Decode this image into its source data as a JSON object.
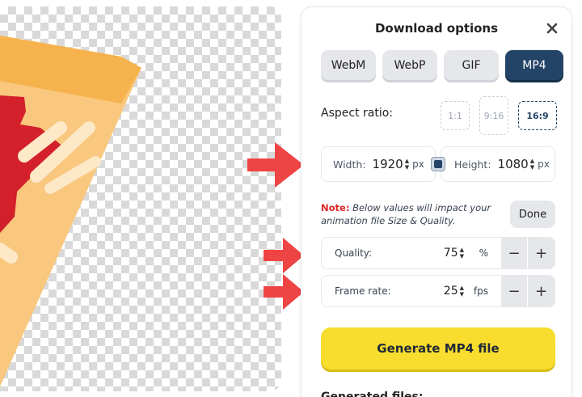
{
  "panel": {
    "title": "Download options",
    "formats": [
      {
        "label": "WebM",
        "active": false
      },
      {
        "label": "WebP",
        "active": false
      },
      {
        "label": "GIF",
        "active": false
      },
      {
        "label": "MP4",
        "active": true
      }
    ],
    "aspect_ratio": {
      "label": "Aspect ratio:",
      "options": [
        "1:1",
        "9:16",
        "16:9"
      ],
      "selected": "16:9"
    },
    "dimensions": {
      "width_label": "Width:",
      "width_value": "1920",
      "height_label": "Height:",
      "height_value": "1080",
      "unit": "px"
    },
    "note": {
      "prefix": "Note:",
      "text": "Below values will impact your animation file Size & Quality."
    },
    "done_label": "Done",
    "quality": {
      "label": "Quality:",
      "value": "75",
      "unit": "%"
    },
    "frame_rate": {
      "label": "Frame rate:",
      "value": "25",
      "unit": "fps"
    },
    "generate_label": "Generate MP4 file",
    "generated_files_label": "Generated files:"
  },
  "colors": {
    "accent": "#234466",
    "generate": "#f8dc2e",
    "arrow": "#ef4444",
    "note": "#dc2626"
  },
  "icons": [
    "close-icon",
    "lock-aspect-icon",
    "red-arrow-icon"
  ]
}
